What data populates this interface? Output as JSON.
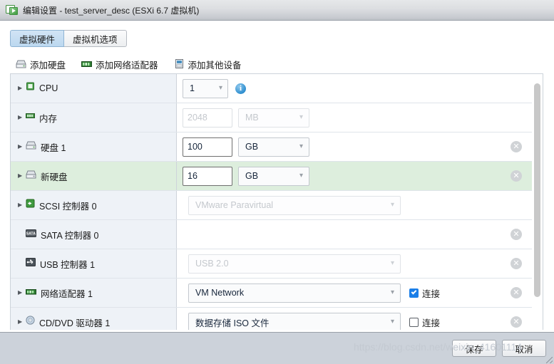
{
  "window": {
    "title": "编辑设置 - test_server_desc (ESXi 6.7 虚拟机)",
    "icon": "virtual-machine-icon"
  },
  "tabs": [
    {
      "label": "虚拟硬件",
      "active": true
    },
    {
      "label": "虚拟机选项",
      "active": false
    }
  ],
  "toolbar": {
    "add_hard_disk": "添加硬盘",
    "add_network_adapter": "添加网络适配器",
    "add_other_device": "添加其他设备"
  },
  "devices": [
    {
      "name": "CPU",
      "icon": "cpu-icon",
      "expandable": true,
      "highlighted": false,
      "value": "1",
      "control": "cpu-select",
      "info": "i",
      "removable": false
    },
    {
      "name": "内存",
      "icon": "memory-icon",
      "expandable": true,
      "highlighted": false,
      "value": "2048",
      "unit": "MB",
      "control": "text-unit",
      "disabled": true,
      "removable": false
    },
    {
      "name": "硬盘 1",
      "icon": "hard-disk-icon",
      "expandable": true,
      "highlighted": false,
      "value": "100",
      "unit": "GB",
      "control": "text-unit",
      "disabled": false,
      "removable": true
    },
    {
      "name": "新硬盘",
      "icon": "hard-disk-icon",
      "expandable": true,
      "highlighted": true,
      "value": "16",
      "unit": "GB",
      "control": "text-unit",
      "disabled": false,
      "removable": true
    },
    {
      "name": "SCSI 控制器 0",
      "icon": "scsi-controller-icon",
      "expandable": true,
      "highlighted": false,
      "value": "VMware Paravirtual",
      "control": "wide-select",
      "disabled": true,
      "removable": false
    },
    {
      "name": "SATA 控制器 0",
      "icon": "sata-controller-icon",
      "expandable": false,
      "highlighted": false,
      "value": "",
      "control": "none",
      "removable": true
    },
    {
      "name": "USB 控制器 1",
      "icon": "usb-controller-icon",
      "expandable": false,
      "highlighted": false,
      "value": "USB 2.0",
      "control": "wide-select",
      "disabled": true,
      "removable": true
    },
    {
      "name": "网络适配器 1",
      "icon": "network-adapter-icon",
      "expandable": true,
      "highlighted": false,
      "value": "VM Network",
      "control": "wide-select",
      "disabled": false,
      "checkbox_label": "连接",
      "checked": true,
      "removable": true
    },
    {
      "name": "CD/DVD 驱动器 1",
      "icon": "cd-dvd-drive-icon",
      "expandable": true,
      "highlighted": false,
      "value": "数据存储 ISO 文件",
      "control": "wide-select",
      "disabled": false,
      "checkbox_label": "连接",
      "checked": false,
      "removable": true
    }
  ],
  "footer": {
    "save_label": "保存",
    "cancel_label": "取消"
  },
  "watermark": "https://blog.csdn.net/weixin_41601114"
}
